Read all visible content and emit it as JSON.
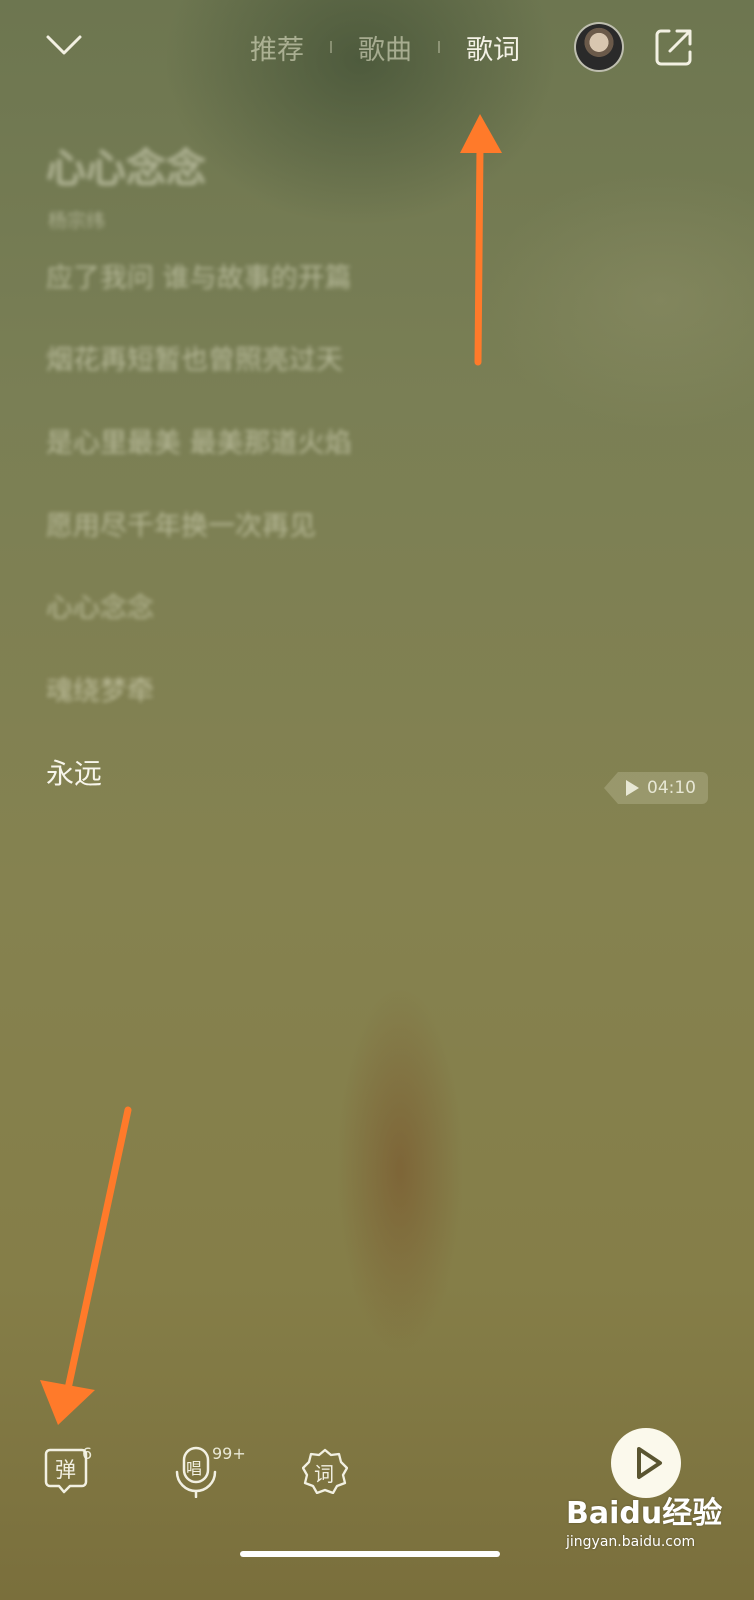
{
  "header": {
    "tabs": [
      {
        "label": "推荐",
        "active": false
      },
      {
        "label": "歌曲",
        "active": false
      },
      {
        "label": "歌词",
        "active": true
      }
    ]
  },
  "lyrics": {
    "title": "心心念念",
    "artist": "杨宗纬",
    "lines": [
      "应了我问 谁与故事的开篇",
      "烟花再短暂也曾照亮过天",
      "是心里最美 最美那道火焰",
      "愿用尽千年换一次再见",
      "心心念念",
      "魂绕梦牵",
      "永远"
    ],
    "current_line_index": 6,
    "seek_time": "04:10"
  },
  "bottom_bar": {
    "danmaku": {
      "label": "弹",
      "count": "6"
    },
    "sing": {
      "label": "唱",
      "count": "99+"
    },
    "lyrics_btn": {
      "label": "词"
    }
  },
  "watermark": {
    "main": "Baidu经验",
    "url": "jingyan.baidu.com"
  },
  "colors": {
    "annotation_arrow": "#ff7a2a",
    "active_text": "#f7f5ea",
    "play_button": "#fbf9ec"
  },
  "icons": [
    "chevron-down-icon",
    "share-icon",
    "avatar",
    "play-icon",
    "mic-icon",
    "danmaku-bubble-icon",
    "lyrics-badge-icon"
  ]
}
